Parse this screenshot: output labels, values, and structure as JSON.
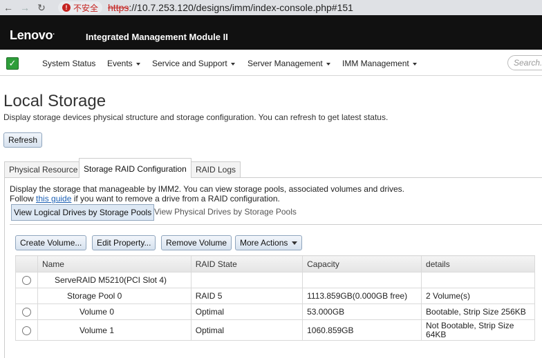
{
  "browser": {
    "security_label": "不安全",
    "url_scheme": "https",
    "url_rest": "://10.7.253.120/designs/imm/index-console.php#151"
  },
  "app": {
    "logo": "Lenovo",
    "title": "Integrated Management Module II"
  },
  "nav": {
    "items": [
      {
        "label": "System Status",
        "dropdown": false
      },
      {
        "label": "Events",
        "dropdown": true
      },
      {
        "label": "Service and Support",
        "dropdown": true
      },
      {
        "label": "Server Management",
        "dropdown": true
      },
      {
        "label": "IMM Management",
        "dropdown": true
      }
    ],
    "search_placeholder": "Search..."
  },
  "page": {
    "title": "Local Storage",
    "description": "Display storage devices physical structure and storage configuration. You can refresh to get latest status.",
    "refresh_label": "Refresh"
  },
  "tabs": [
    {
      "label": "Physical Resource",
      "active": false
    },
    {
      "label": "Storage RAID Configuration",
      "active": true
    },
    {
      "label": "RAID Logs",
      "active": false
    }
  ],
  "panel": {
    "intro": "Display the storage that manageable by IMM2. You can view storage pools, associated volumes and drives.",
    "follow_prefix": "Follow ",
    "guide_link": "this guide",
    "follow_suffix": " if you want to remove a drive from a RAID configuration.",
    "subtab_active": "View Logical Drives by Storage Pools",
    "subtab_inactive": "View Physical Drives by Storage Pools"
  },
  "actions": {
    "create": "Create Volume...",
    "edit": "Edit Property...",
    "remove": "Remove Volume",
    "more": "More Actions"
  },
  "table": {
    "columns": [
      "Name",
      "RAID State",
      "Capacity",
      "details"
    ],
    "rows": [
      {
        "radio": true,
        "name": "ServeRAID M5210(PCI Slot 4)",
        "raid": "",
        "capacity": "",
        "details": ""
      },
      {
        "radio": false,
        "name": "Storage Pool 0",
        "raid": "RAID 5",
        "capacity": "1113.859GB(0.000GB free)",
        "details": "2 Volume(s)"
      },
      {
        "radio": true,
        "name": "Volume 0",
        "raid": "Optimal",
        "capacity": "53.000GB",
        "details": "Bootable, Strip Size 256KB"
      },
      {
        "radio": true,
        "name": "Volume 1",
        "raid": "Optimal",
        "capacity": "1060.859GB",
        "details": "Not Bootable, Strip Size 64KB"
      }
    ]
  }
}
